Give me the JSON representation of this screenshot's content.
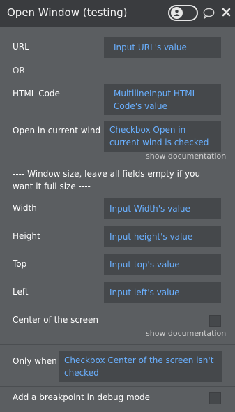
{
  "header": {
    "title": "Open Window (testing)"
  },
  "fields": {
    "url": {
      "label": "URL",
      "value": "Input URL's value"
    },
    "or": "OR",
    "html_code": {
      "label": "HTML Code",
      "value": "MultilineInput HTML Code's value"
    },
    "open_current": {
      "label": "Open in current wind",
      "value": "Checkbox Open in current wind is checked",
      "doc": "show documentation"
    },
    "window_size_note": "---- Window size, leave all fields empty if you want it full size ----",
    "width": {
      "label": "Width",
      "value": "Input Width's value"
    },
    "height": {
      "label": "Height",
      "value": "Input height's value"
    },
    "top": {
      "label": "Top",
      "value": "Input top's value"
    },
    "left": {
      "label": "Left",
      "value": "Input left's value"
    },
    "center": {
      "label": "Center of the screen",
      "doc": "show documentation"
    },
    "only_when": {
      "label": "Only when",
      "value": "Checkbox Center of the screen isn't checked"
    },
    "breakpoint": {
      "label": "Add a breakpoint in debug mode"
    }
  },
  "icons": {
    "toggle": "person-icon",
    "comment": "comment-icon",
    "close": "close-icon"
  },
  "colors": {
    "background": "#5b5e61",
    "header": "#3a3c3f",
    "field_bg": "#45484b",
    "field_text": "#6ab0ff"
  }
}
